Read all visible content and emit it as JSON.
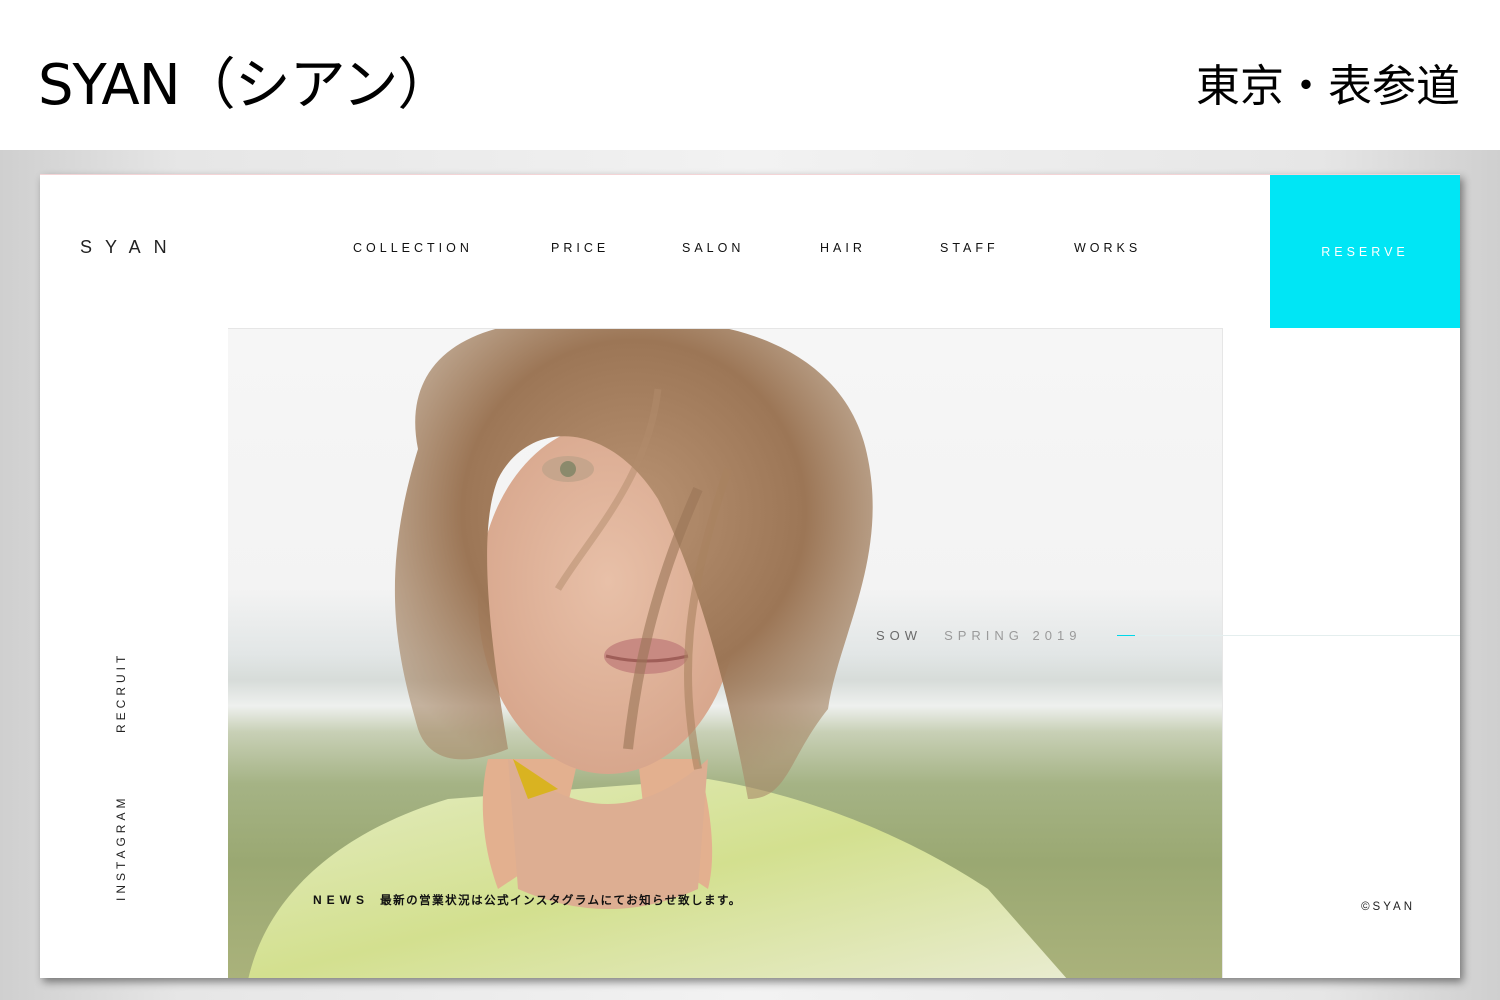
{
  "header": {
    "title": "SYAN（シアン）",
    "location": "東京・表参道"
  },
  "site": {
    "logo": "SYAN",
    "nav": [
      "COLLECTION",
      "PRICE",
      "SALON",
      "HAIR",
      "STAFF",
      "WORKS"
    ],
    "reserve_label": "RESERVE",
    "accent_color": "#00e6f5",
    "hero": {
      "collection": "SOW",
      "season": "SPRING 2019"
    },
    "news": {
      "label": "NEWS",
      "text": "最新の営業状況は公式インスタグラムにてお知らせ致します。"
    },
    "side_links": [
      "RECRUIT",
      "INSTAGRAM"
    ],
    "copyright": "©SYAN"
  }
}
